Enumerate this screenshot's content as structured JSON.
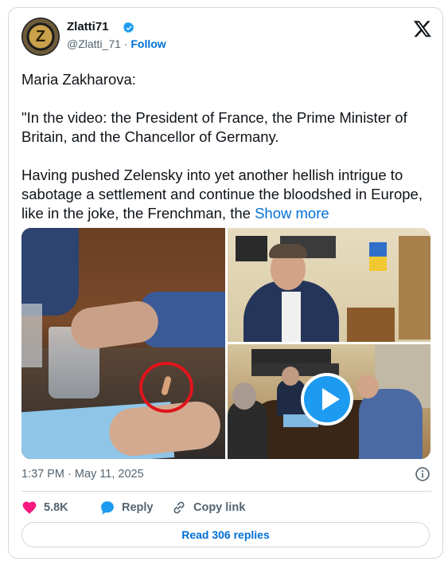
{
  "author": {
    "name": "Zlatti71",
    "handle": "@Zlatti_71",
    "separator": "·",
    "follow_label": "Follow",
    "avatar_letter": "Z"
  },
  "tweet": {
    "line1": "Maria Zakharova:",
    "paragraph2": "\"In the video: the President of France, the Prime Minister of Britain, and the Chancellor of Germany.",
    "paragraph3": "Having pushed Zelensky into yet another hellish intrigue to sabotage a settlement and continue the bloodshed in Europe, like in the joke, the Frenchman, the",
    "show_more": "Show more"
  },
  "timestamp": "1:37 PM · May 11, 2025",
  "actions": {
    "likes": "5.8K",
    "reply_label": "Reply",
    "copy_link_label": "Copy link"
  },
  "read_replies_label": "Read 306 replies",
  "colors": {
    "link": "#006fd6",
    "heart": "#f91880",
    "reply_bubble": "#1d9bf0",
    "verified": "#1d9bf0",
    "play": "#1d9bf0"
  },
  "icons": {
    "verified": "verified-badge-icon",
    "x_logo": "x-logo-icon",
    "info": "info-icon",
    "heart": "heart-icon",
    "reply": "reply-bubble-icon",
    "link": "link-icon",
    "play": "play-icon"
  }
}
